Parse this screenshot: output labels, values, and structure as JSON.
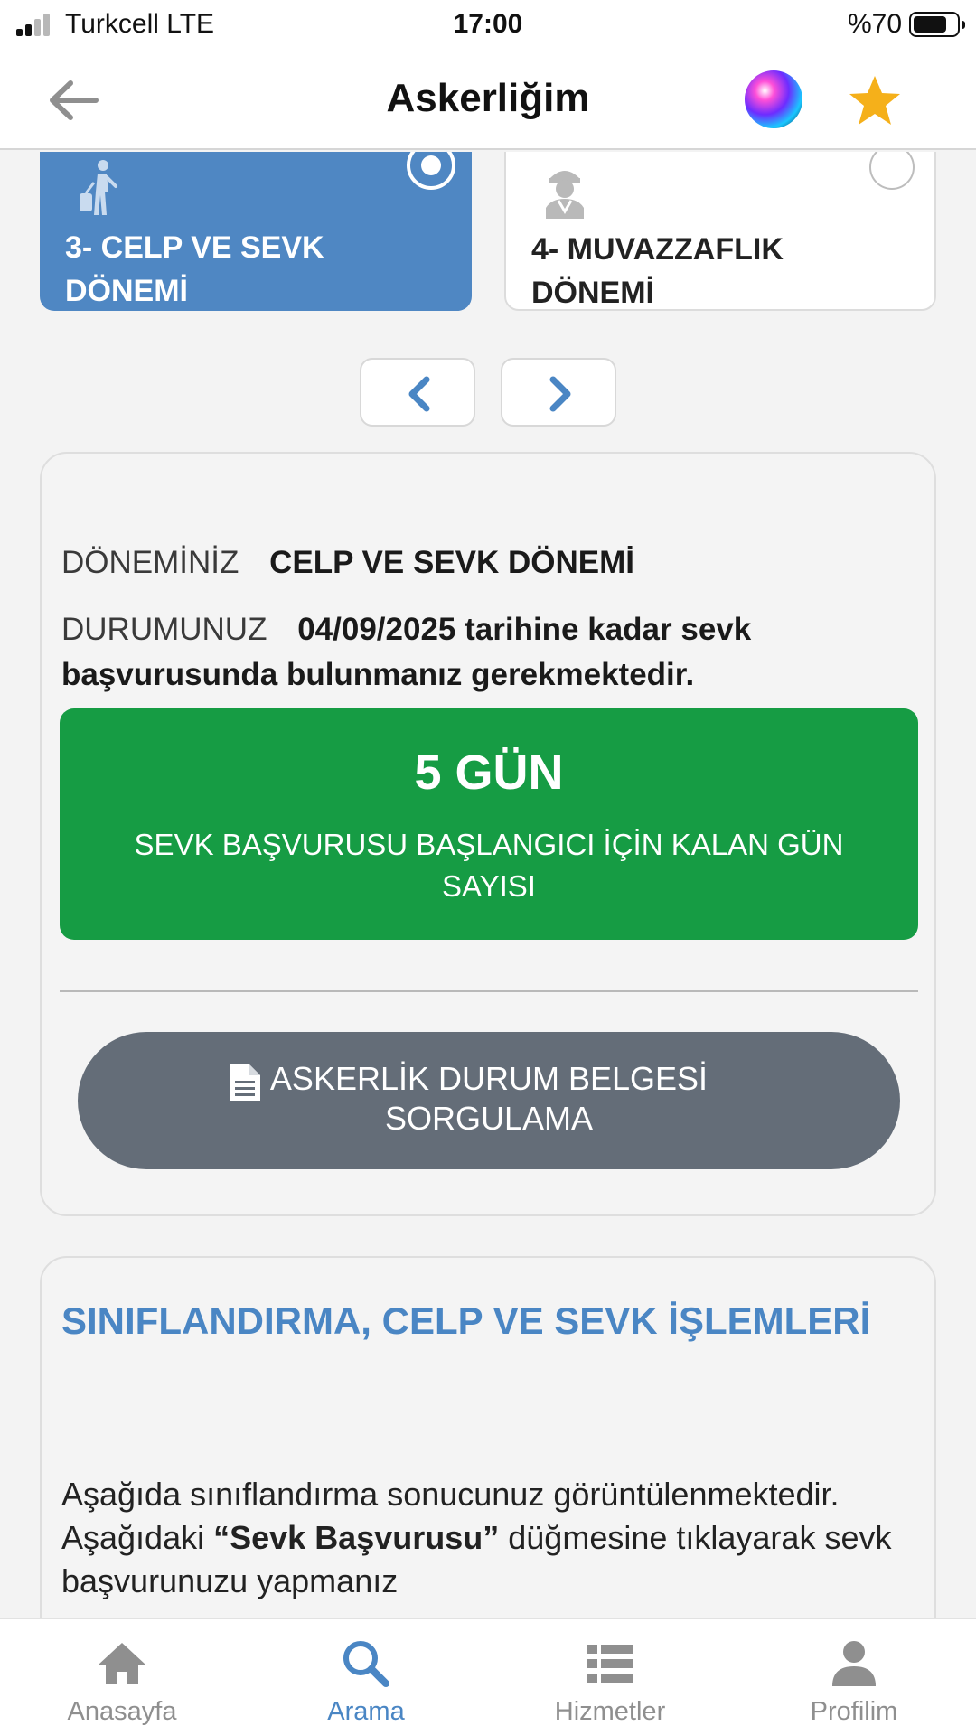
{
  "status_bar": {
    "carrier": "Turkcell  LTE",
    "time": "17:00",
    "battery": "%70"
  },
  "header": {
    "title": "Askerliğim",
    "back_icon": "arrow-left-icon",
    "assistant_icon": "siri-icon",
    "favorite_icon": "star-icon"
  },
  "periods": [
    {
      "label": "3- CELP VE SEVK DÖNEMİ",
      "icon": "walking-with-luggage-icon",
      "selected": true
    },
    {
      "label": "4- MUVAZZAFLIK DÖNEMİ",
      "icon": "soldier-icon",
      "selected": false
    }
  ],
  "pager": {
    "prev_icon": "chevron-left-icon",
    "next_icon": "chevron-right-icon"
  },
  "status_card": {
    "period_key": "DÖNEMİNİZ",
    "period_value": "CELP VE SEVK DÖNEMİ",
    "state_key": "DURUMUNUZ",
    "state_value": "04/09/2025 tarihine kadar sevk başvurusunda bulunmanız gerekmektedir.",
    "countdown_value": "5 GÜN",
    "countdown_label": "SEVK BAŞVURUSU BAŞLANGICI İÇİN KALAN GÜN SAYISI",
    "doc_button_label": "ASKERLİK DURUM BELGESİ SORGULAMA"
  },
  "info_card": {
    "title": "SINIFLANDIRMA, CELP VE SEVK İŞLEMLERİ",
    "body_before": "Aşağıda sınıflandırma sonucunuz görüntülenmektedir. Aşağıdaki ",
    "body_emphasis": "“Sevk Başvurusu”",
    "body_after": " düğmesine tıklayarak sevk başvurunuzu yapmanız"
  },
  "tabs": [
    {
      "label": "Anasayfa",
      "icon": "home-icon",
      "active": false
    },
    {
      "label": "Arama",
      "icon": "search-icon",
      "active": true
    },
    {
      "label": "Hizmetler",
      "icon": "list-icon",
      "active": false
    },
    {
      "label": "Profilim",
      "icon": "user-icon",
      "active": false
    }
  ],
  "colors": {
    "accent_blue": "#4f87c3",
    "countdown_green": "#169c44",
    "button_gray": "#646d78",
    "star_gold": "#f5b01a"
  }
}
